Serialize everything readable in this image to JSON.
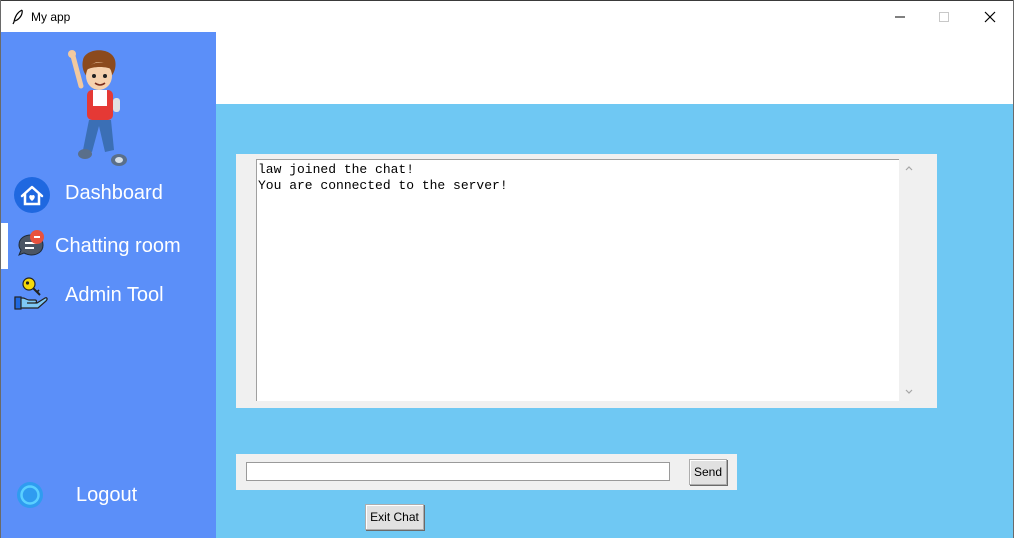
{
  "window": {
    "title": "My app",
    "app_icon": "feather-icon",
    "controls": [
      "minimize-icon",
      "maximize-icon",
      "close-icon"
    ]
  },
  "sidebar": {
    "avatar": "cartoon-boy-avatar",
    "items": [
      {
        "label": "Dashboard",
        "icon": "home-heart-icon",
        "active": false
      },
      {
        "label": "Chatting room",
        "icon": "chat-bubble-icon",
        "active": true
      },
      {
        "label": "Admin Tool",
        "icon": "key-hand-icon",
        "active": false
      }
    ],
    "logout": {
      "label": "Logout",
      "icon": "logout-circle-icon"
    }
  },
  "chat": {
    "messages": [
      "law joined the chat!",
      "You are connected to the server!"
    ],
    "input_value": "",
    "send_label": "Send",
    "exit_label": "Exit Chat"
  },
  "colors": {
    "sidebar": "#5b8ff9",
    "main_background": "#6fc8f3",
    "panel": "#f0f0f0",
    "button": "#e1e1e1",
    "notification": "#e8523e"
  }
}
